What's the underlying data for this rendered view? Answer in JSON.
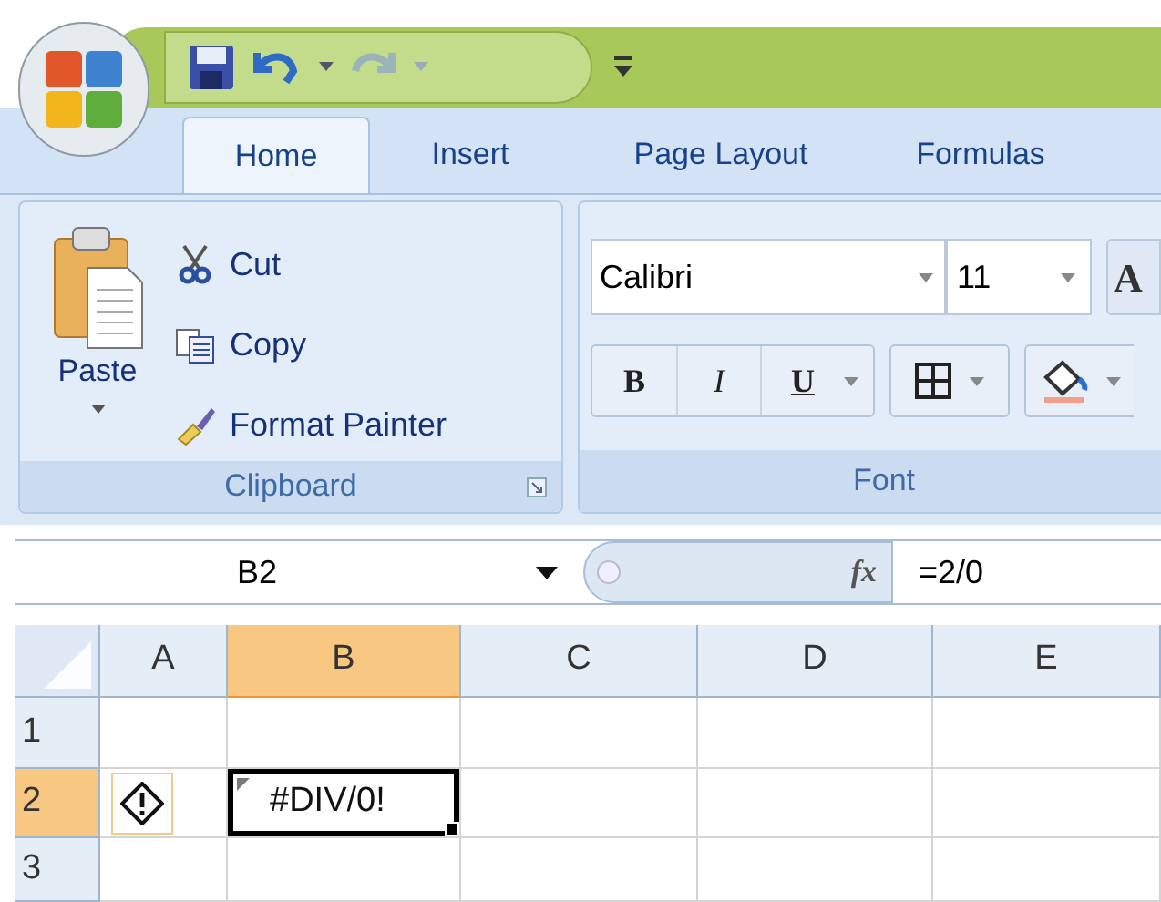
{
  "tabs": [
    {
      "label": "Home",
      "selected": true
    },
    {
      "label": "Insert",
      "selected": false
    },
    {
      "label": "Page Layout",
      "selected": false
    },
    {
      "label": "Formulas",
      "selected": false
    }
  ],
  "clipboard": {
    "paste": "Paste",
    "items": [
      {
        "kind": "cut",
        "label": "Cut"
      },
      {
        "kind": "copy",
        "label": "Copy"
      },
      {
        "kind": "painter",
        "label": "Format Painter"
      }
    ],
    "group_label": "Clipboard"
  },
  "font": {
    "font_name": "Calibri",
    "font_size": "11",
    "grow_font": "A",
    "styles": [
      {
        "kind": "bold",
        "label": "B"
      },
      {
        "kind": "italic",
        "label": "I"
      },
      {
        "kind": "underline",
        "label": "U"
      }
    ],
    "group_label": "Font"
  },
  "formula_bar": {
    "name_box": "B2",
    "function_label": "fx",
    "formula": "=2/0"
  },
  "grid": {
    "columns": [
      {
        "label": "A",
        "selected": false
      },
      {
        "label": "B",
        "selected": true
      },
      {
        "label": "C",
        "selected": false
      },
      {
        "label": "D",
        "selected": false
      },
      {
        "label": "E",
        "selected": false
      }
    ],
    "rows": [
      {
        "label": "1",
        "selected": false,
        "cells": [
          {
            "kind": "empty"
          },
          {
            "kind": "empty"
          },
          {
            "kind": "empty"
          },
          {
            "kind": "empty"
          },
          {
            "kind": "empty"
          }
        ]
      },
      {
        "label": "2",
        "selected": true,
        "cells": [
          {
            "kind": "error_indicator"
          },
          {
            "kind": "value",
            "value": "#DIV/0!",
            "selected": true
          },
          {
            "kind": "empty"
          },
          {
            "kind": "empty"
          },
          {
            "kind": "empty"
          }
        ]
      },
      {
        "label": "3",
        "selected": false,
        "cells": [
          {
            "kind": "empty"
          },
          {
            "kind": "empty"
          },
          {
            "kind": "empty"
          },
          {
            "kind": "empty"
          },
          {
            "kind": "empty"
          }
        ]
      }
    ]
  }
}
